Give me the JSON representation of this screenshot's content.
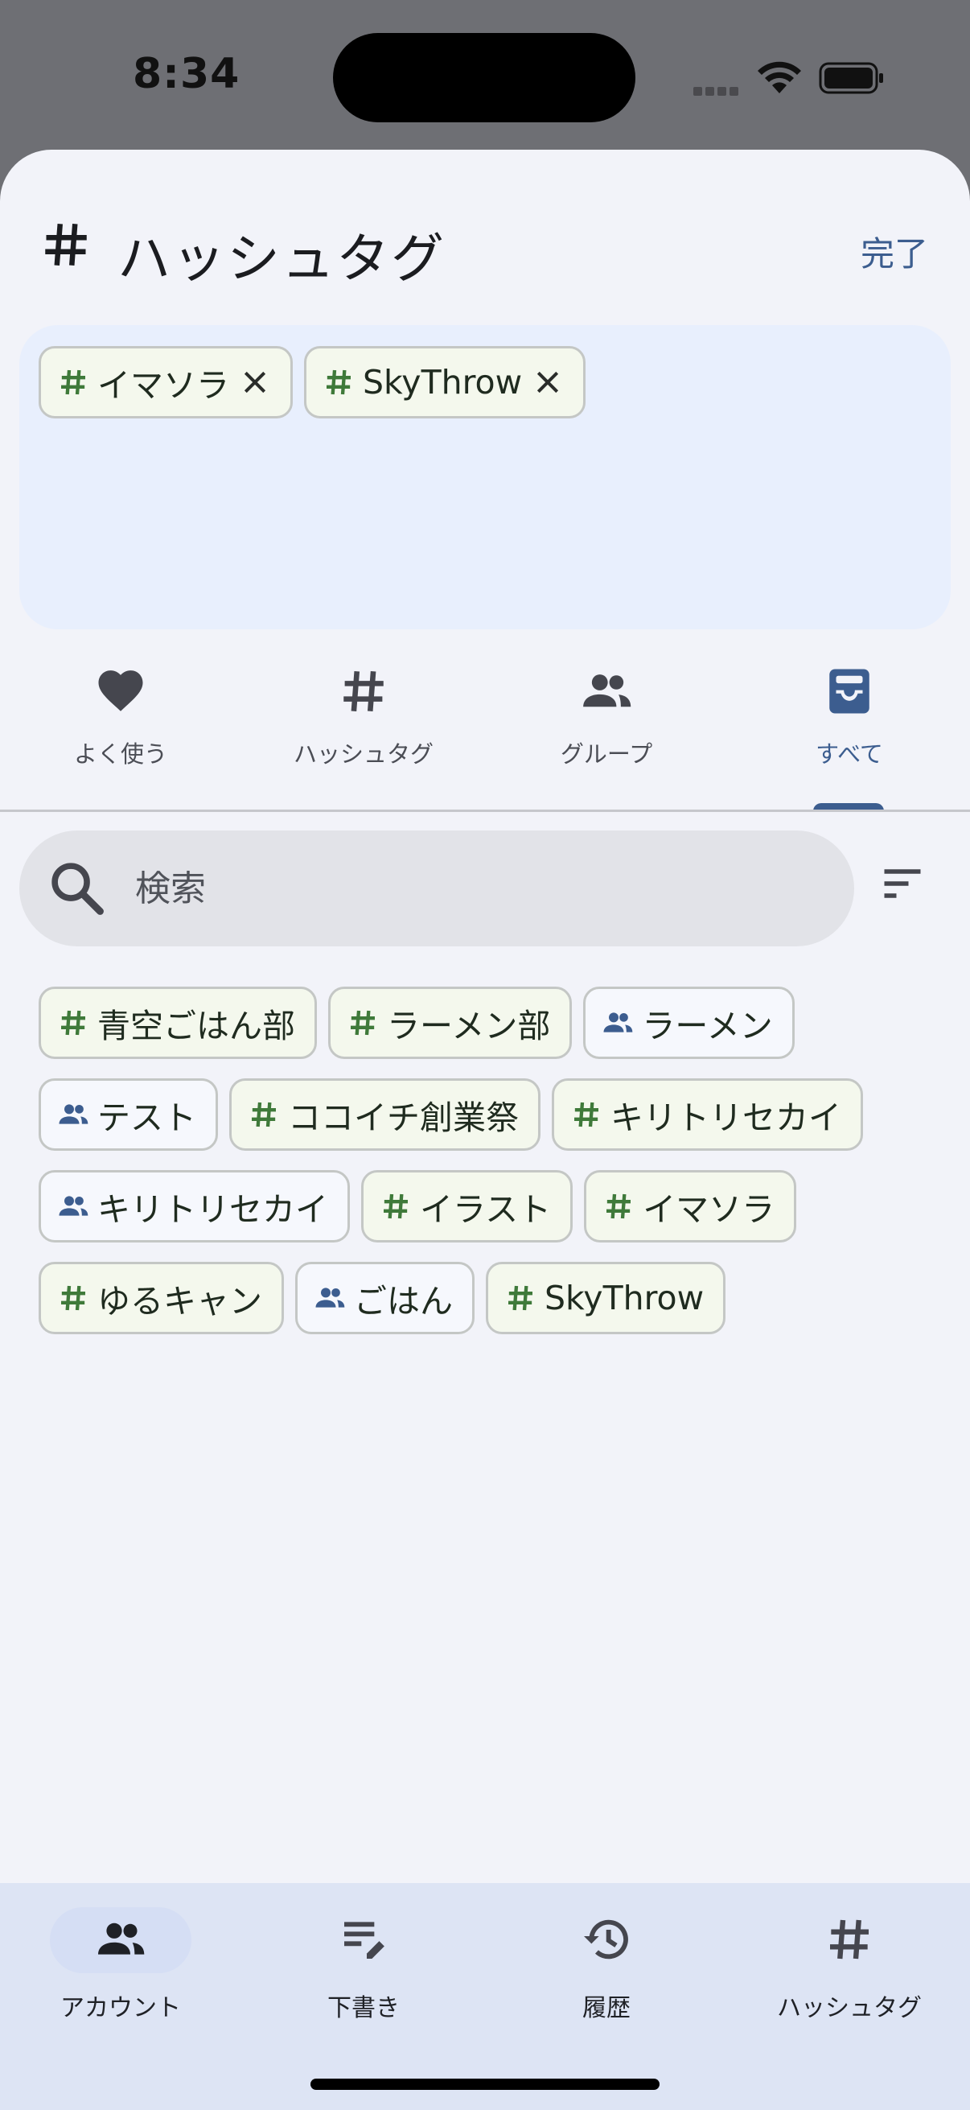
{
  "status_bar": {
    "time": "8:34"
  },
  "header": {
    "title": "ハッシュタグ",
    "done_label": "完了"
  },
  "selected_tags": [
    {
      "label": "イマソラ",
      "kind": "hashtag"
    },
    {
      "label": "SkyThrow",
      "kind": "hashtag"
    }
  ],
  "tabs": [
    {
      "label": "よく使う",
      "icon": "heart-icon",
      "active": false
    },
    {
      "label": "ハッシュタグ",
      "icon": "hash-icon",
      "active": false
    },
    {
      "label": "グループ",
      "icon": "group-icon",
      "active": false
    },
    {
      "label": "すべて",
      "icon": "inbox-icon",
      "active": true
    }
  ],
  "search": {
    "placeholder": "検索",
    "value": ""
  },
  "tags": [
    {
      "label": "青空ごはん部",
      "kind": "hashtag"
    },
    {
      "label": "ラーメン部",
      "kind": "hashtag"
    },
    {
      "label": "ラーメン",
      "kind": "group"
    },
    {
      "label": "テスト",
      "kind": "group"
    },
    {
      "label": "ココイチ創業祭",
      "kind": "hashtag"
    },
    {
      "label": "キリトリセカイ",
      "kind": "hashtag"
    },
    {
      "label": "キリトリセカイ",
      "kind": "group"
    },
    {
      "label": "イラスト",
      "kind": "hashtag"
    },
    {
      "label": "イマソラ",
      "kind": "hashtag"
    },
    {
      "label": "ゆるキャン",
      "kind": "hashtag"
    },
    {
      "label": "ごはん",
      "kind": "group"
    },
    {
      "label": "SkyThrow",
      "kind": "hashtag"
    }
  ],
  "bottom_nav": [
    {
      "label": "アカウント",
      "icon": "group-icon",
      "active": true
    },
    {
      "label": "下書き",
      "icon": "draft-edit-icon",
      "active": false
    },
    {
      "label": "履歴",
      "icon": "history-icon",
      "active": false
    },
    {
      "label": "ハッシュタグ",
      "icon": "hash-icon",
      "active": false
    }
  ],
  "colors": {
    "accent": "#3c5d8f",
    "hashtag_icon": "#3f7a3a",
    "group_icon": "#3c5d8f",
    "sheet_bg": "#f2f3f9",
    "selected_area_bg": "#e8effd",
    "bottom_nav_bg": "#dde4f4"
  }
}
